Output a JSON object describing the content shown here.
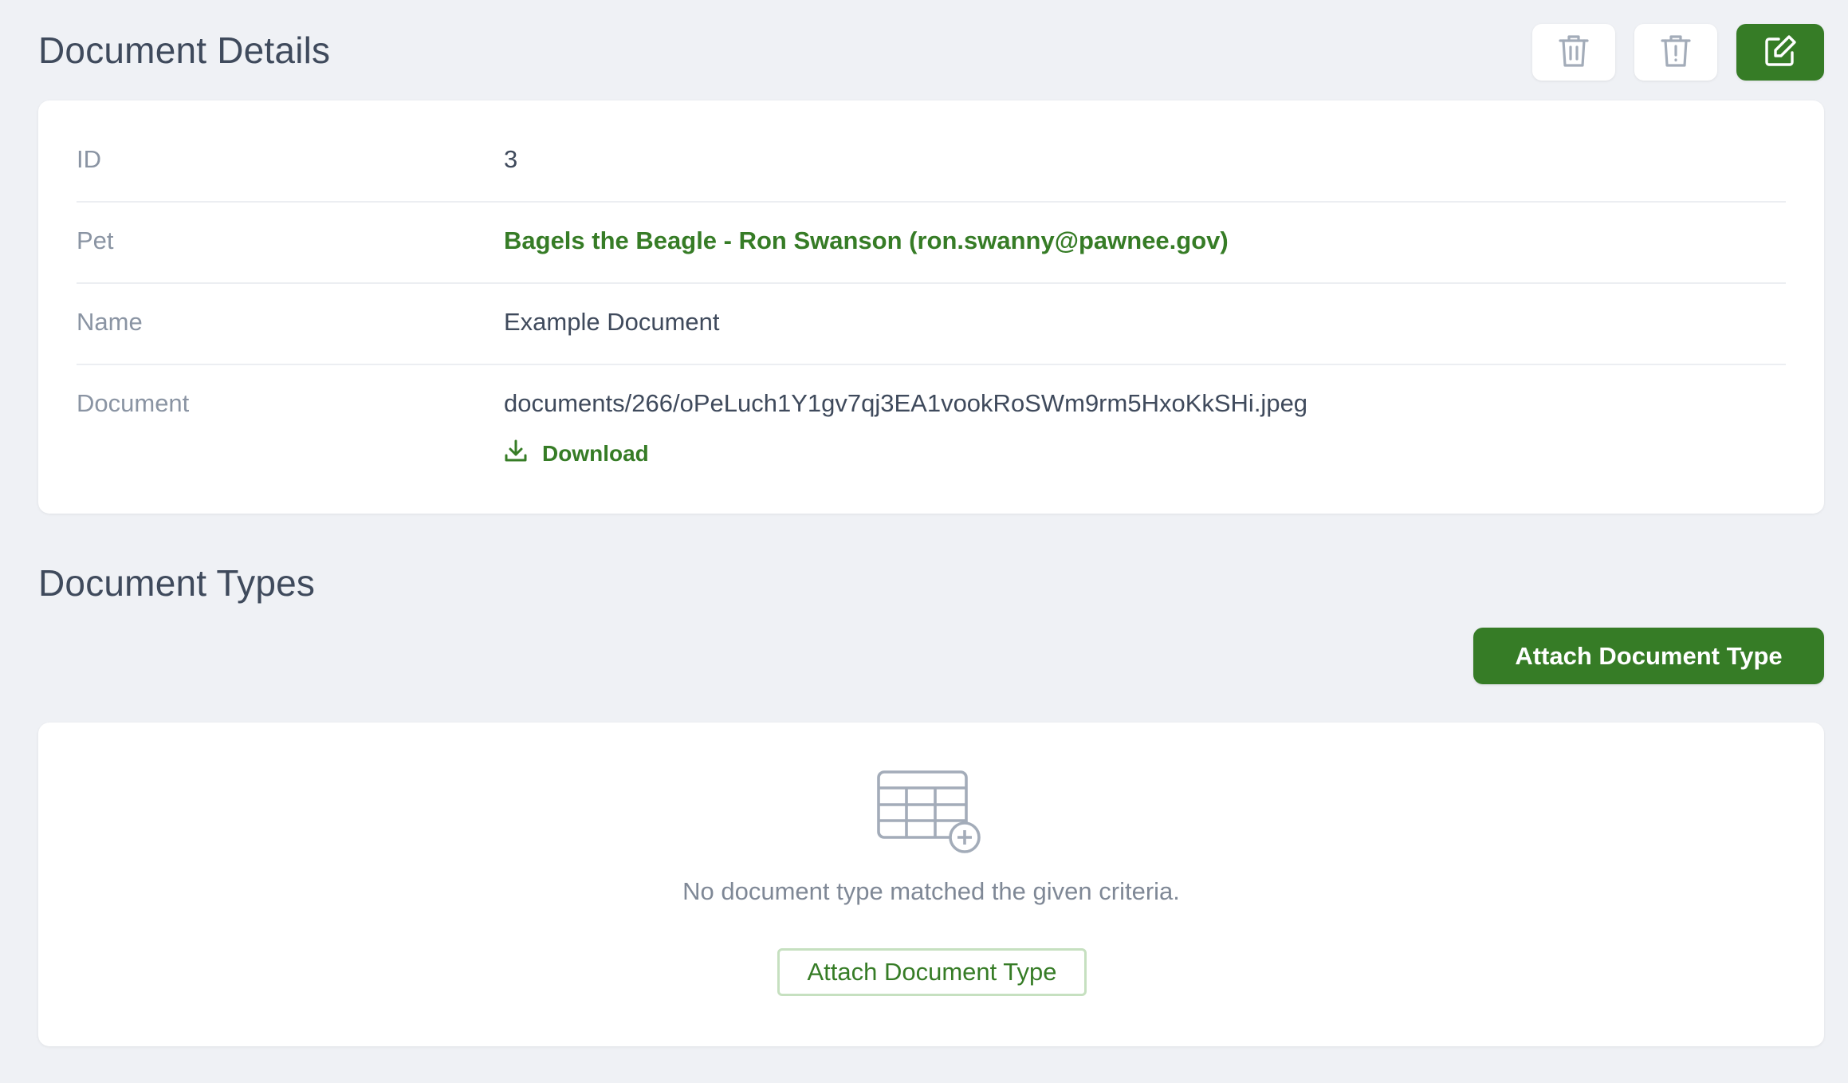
{
  "details": {
    "title": "Document Details",
    "rows": [
      {
        "label": "ID",
        "value": "3"
      },
      {
        "label": "Pet",
        "value": "Bagels the Beagle - Ron Swanson (ron.swanny@pawnee.gov)"
      },
      {
        "label": "Name",
        "value": "Example Document"
      },
      {
        "label": "Document",
        "value": "documents/266/oPeLuch1Y1gv7qj3EA1vookRoSWm9rm5HxoKkSHi.jpeg"
      }
    ],
    "download_label": "Download"
  },
  "toolbar": {
    "buttons": [
      {
        "icon": "trash-icon"
      },
      {
        "icon": "trash-alert-icon"
      },
      {
        "icon": "edit-icon"
      }
    ]
  },
  "types": {
    "title": "Document Types",
    "attach_label": "Attach Document Type",
    "empty_message": "No document type matched the given criteria.",
    "empty_attach_label": "Attach Document Type"
  },
  "colors": {
    "primary": "#367c26",
    "background": "#eff1f5",
    "card": "#ffffff",
    "label": "#8a94a3",
    "text": "#3f4a5c"
  }
}
